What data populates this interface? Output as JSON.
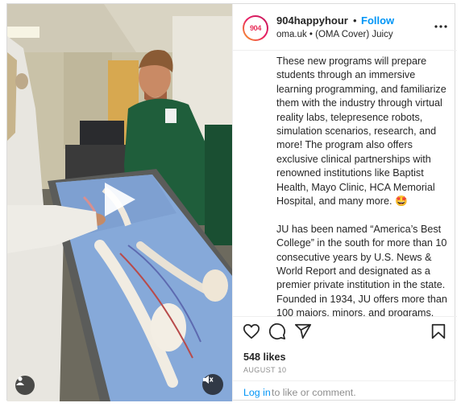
{
  "post": {
    "username": "904happyhour",
    "separator": "•",
    "follow_label": "Follow",
    "avatar_text": "904",
    "subline": "oma.uk • (OMA Cover) Juicy",
    "more_icon": "more-options-icon",
    "caption_paragraphs": [
      "These new programs will prepare students through an immersive learning programming, and familiarize them with the industry through virtual reality labs, telepresence robots, simulation scenarios, research, and more! The program also offers exclusive clinical partnerships with renowned institutions like Baptist Health, Mayo Clinic, HCA Memorial Hospital, and many more. 🤩",
      "JU has been named “America’s Best College” in the south for more than 10 consecutive years by U.S. News & World Report and designated as a premier private institution in the state. Founded in 1934, JU offers more than 100 majors, minors, and programs, including degrees in Business, Marine Science,"
    ],
    "likes": "548 likes",
    "date": "AUGUST 10",
    "login_link": "Log in",
    "login_rest": "to like or comment."
  },
  "media": {
    "type": "video",
    "play_icon": "play-icon",
    "user_tag_icon": "user-tag-icon",
    "mute_icon": "muted-speaker-icon"
  },
  "actions": {
    "like_icon": "heart-icon",
    "comment_icon": "comment-icon",
    "share_icon": "share-icon",
    "save_icon": "bookmark-icon"
  },
  "colors": {
    "accent": "#0095f6",
    "text": "#262626",
    "muted": "#8e8e8e",
    "border": "#dbdbdb",
    "avatar_ring_start": "#f9a825",
    "avatar_ring_end": "#c2185b"
  }
}
